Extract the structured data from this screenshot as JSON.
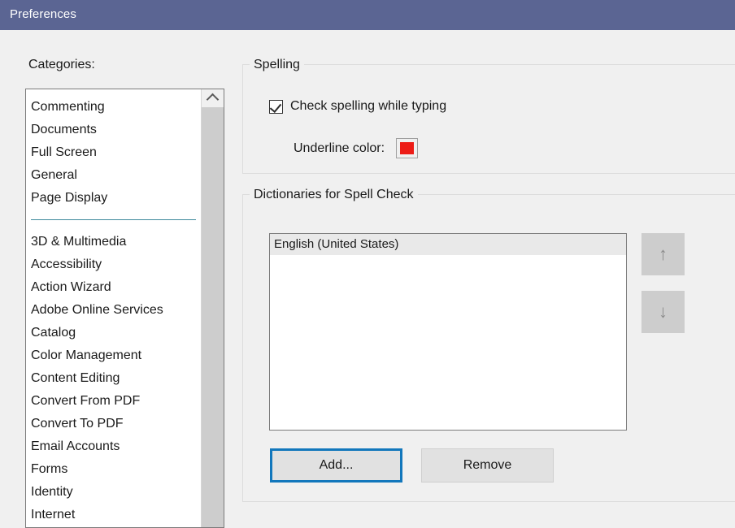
{
  "window": {
    "title": "Preferences",
    "titlebar_color": "#5b6593",
    "background_color": "#f0f0f0"
  },
  "categories": {
    "label": "Categories:",
    "items": [
      "Commenting",
      "Documents",
      "Full Screen",
      "General",
      "Page Display"
    ],
    "separator_color": "#3f8a9c",
    "items_secondary": [
      "3D & Multimedia",
      "Accessibility",
      "Action Wizard",
      "Adobe Online Services",
      "Catalog",
      "Color Management",
      "Content Editing",
      "Convert From PDF",
      "Convert To PDF",
      "Email Accounts",
      "Forms",
      "Identity",
      "Internet"
    ],
    "scrollbar": {
      "up_icon": "chevron-up-icon"
    }
  },
  "spelling": {
    "group_title": "Spelling",
    "check_spelling": {
      "label": "Check spelling while typing",
      "checked": true
    },
    "underline_color": {
      "label": "Underline color:",
      "value": "#ed1c16"
    }
  },
  "dictionaries": {
    "group_title": "Dictionaries for Spell Check",
    "items": [
      {
        "label": "English (United States)",
        "selected": true
      }
    ],
    "move_up_icon": "arrow-up-icon",
    "move_down_icon": "arrow-down-icon",
    "move_up_glyph": "↑",
    "move_down_glyph": "↓",
    "add_button": "Add...",
    "remove_button": "Remove",
    "focus_color": "#1277bc"
  }
}
